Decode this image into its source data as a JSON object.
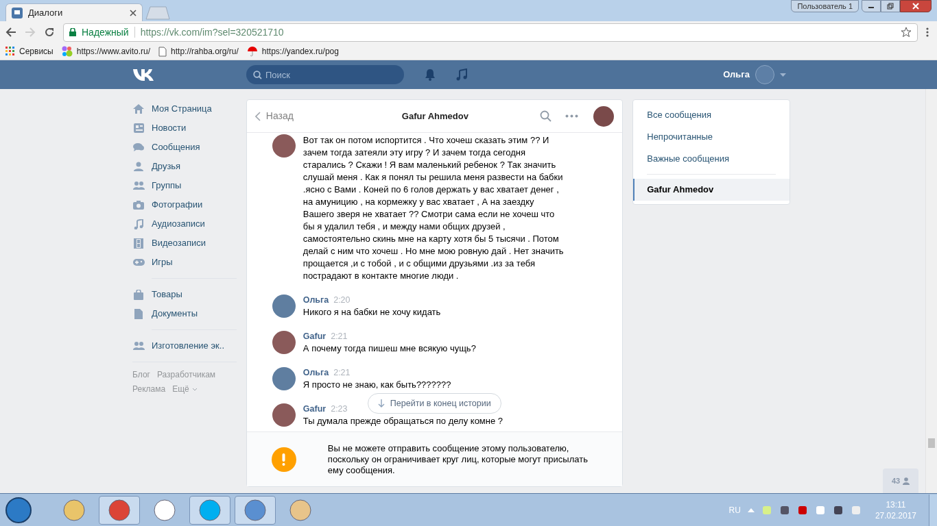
{
  "browser": {
    "tab_title": "Диалоги",
    "profile": "Пользователь 1",
    "security": "Надежный",
    "url": "https://vk.com/im?sel=320521710",
    "bookmarks": [
      "Сервисы",
      "https://www.avito.ru/",
      "http://rahba.org/ru/",
      "https://yandex.ru/pog"
    ]
  },
  "header": {
    "search": {
      "placeholder": "Поиск"
    },
    "user_name": "Ольга"
  },
  "sidebar": {
    "groups": [
      [
        "Моя Страница",
        "Новости",
        "Сообщения",
        "Друзья",
        "Группы",
        "Фотографии",
        "Аудиозаписи",
        "Видеозаписи",
        "Игры"
      ],
      [
        "Товары",
        "Документы"
      ],
      [
        "Изготовление эк.."
      ]
    ],
    "footer_links": [
      "Блог",
      "Разработчикам",
      "Реклама",
      "Ещё"
    ]
  },
  "chat": {
    "back": "Назад",
    "title": "Gafur Ahmedov",
    "messages": [
      {
        "text": "Вот так он потом испортится . Что хочеш сказать этим ?? И зачем тогда затеяли эту игру ? И зачем тогда сегодня старались ? Скажи ! Я вам маленький ребенок ? Так значить слушай меня . Как я понял ты решила меня развести на бабки .ясно с Вами . Коней по 6 голов держать у вас хватает денег , на амуницию , на кормежку у вас хватает , А на заездку Вашего зверя не хватает ?? Смотри сама если не хочеш что бы я удалил тебя , и между нами общих друзей , самостоятельно скинь мне на карту хотя бы 5 тысячи . Потом делай с ним что хочеш . Но мне мою ровную дай . Нет значить прощается ,и с тобой , и с общими друзьями .из за тебя пострадают в контакте многие люди ."
      },
      {
        "author": "Ольга",
        "time": "2:20",
        "text": "Никого я на бабки не хочу кидать"
      },
      {
        "author": "Gafur",
        "time": "2:21",
        "text": "А почему тогда пишеш мне всякую чущь?"
      },
      {
        "author": "Ольга",
        "time": "2:21",
        "text": "Я просто не знаю, как быть???????"
      },
      {
        "author": "Gafur",
        "time": "2:23",
        "text": "Ты думала прежде обращаться по делу комне ?"
      }
    ],
    "jump_button": "Перейти в конец истории",
    "notice": "Вы не можете отправить сообщение этому пользователю, поскольку он ограничивает круг лиц, которые могут присылать ему сообщения."
  },
  "filters": [
    {
      "label": "Все сообщения",
      "selected": false
    },
    {
      "label": "Непрочитанные",
      "selected": false
    },
    {
      "label": "Важные сообщения",
      "selected": false
    }
  ],
  "conversations": [
    {
      "label": "Gafur Ahmedov",
      "selected": true
    }
  ],
  "online_count": "43",
  "taskbar": {
    "language": "RU",
    "time": "13:11",
    "date": "27.02.2017"
  }
}
